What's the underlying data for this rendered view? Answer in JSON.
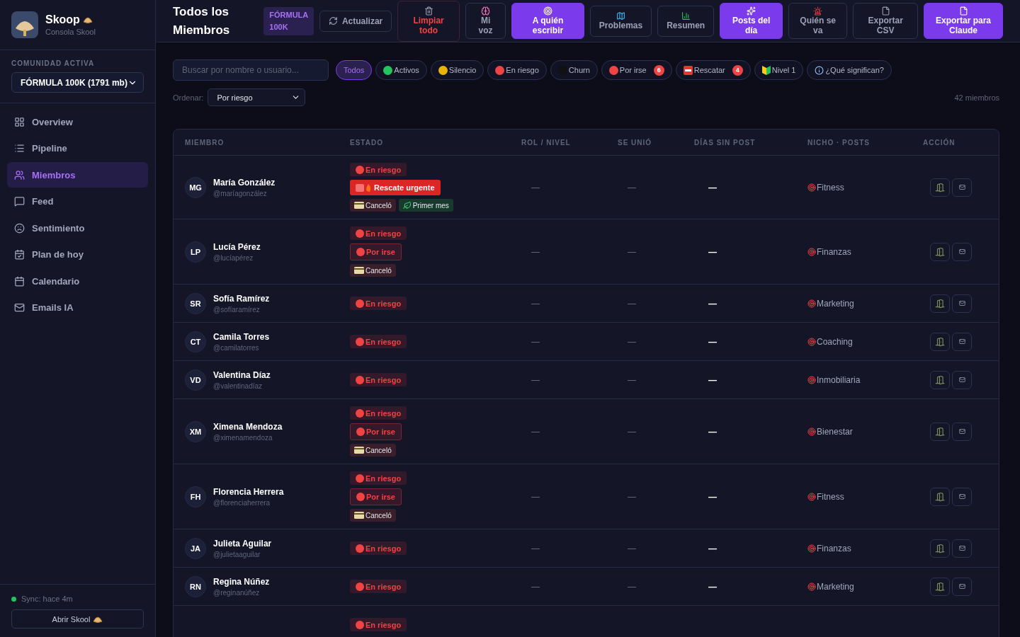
{
  "brand": {
    "name": "Skoop",
    "subtitle": "Consola Skool"
  },
  "community": {
    "label": "COMUNIDAD ACTIVA",
    "value": "FÓRMULA 100K (1791 mb)"
  },
  "nav": [
    {
      "label": "Overview",
      "selected": false
    },
    {
      "label": "Pipeline",
      "selected": false
    },
    {
      "label": "Miembros",
      "selected": true
    },
    {
      "label": "Feed",
      "selected": false
    },
    {
      "label": "Sentimiento",
      "selected": false
    },
    {
      "label": "Plan de hoy",
      "selected": false
    },
    {
      "label": "Calendario",
      "selected": false
    },
    {
      "label": "Emails IA",
      "selected": false
    }
  ],
  "sync": {
    "text": "Sync: hace 4m",
    "color": "#22c55e"
  },
  "open_button": "Abrir Skool",
  "header": {
    "title": "Todos los Miembros",
    "badge": "FÓRMULA 100K"
  },
  "toolbar": [
    {
      "label": "Actualizar",
      "kind": "plain"
    },
    {
      "label": "Limpiar todo",
      "kind": "danger"
    },
    {
      "label": "Mi voz",
      "kind": "plain"
    },
    {
      "label": "A quién escribir",
      "kind": "primary"
    },
    {
      "label": "Problemas",
      "kind": "plain"
    },
    {
      "label": "Resumen",
      "kind": "plain"
    },
    {
      "label": "Posts del día",
      "kind": "primary"
    },
    {
      "label": "Quién se va",
      "kind": "plain"
    },
    {
      "label": "Exportar CSV",
      "kind": "plain"
    },
    {
      "label": "Exportar para Claude",
      "kind": "primary"
    }
  ],
  "search": {
    "placeholder": "Buscar por nombre o usuario..."
  },
  "filters": [
    {
      "label": "Todos",
      "selected": true,
      "kind": "plain"
    },
    {
      "label": "Activos",
      "selected": false,
      "kind": "dot",
      "color": "#22c55e"
    },
    {
      "label": "Silencio",
      "selected": false,
      "kind": "dot",
      "color": "#eab308"
    },
    {
      "label": "En riesgo",
      "selected": false,
      "kind": "dot",
      "color": "#ef4444"
    },
    {
      "label": "Churn",
      "selected": false,
      "kind": "dot",
      "color": "#111111"
    },
    {
      "label": "Por irse",
      "selected": false,
      "kind": "dot",
      "color": "#ef4444",
      "count": "6"
    },
    {
      "label": "Rescatar",
      "selected": false,
      "kind": "sos",
      "count": "4"
    },
    {
      "label": "Nivel 1",
      "selected": false,
      "kind": "leaf"
    },
    {
      "label": "¿Qué significan?",
      "selected": false,
      "kind": "info"
    }
  ],
  "sort": {
    "label": "Ordenar:",
    "value": "Por riesgo"
  },
  "member_count": "42 miembros",
  "table": {
    "columns": [
      "MIEMBRO",
      "ESTADO",
      "ROL / NIVEL",
      "SE UNIÓ",
      "DÍAS SIN POST",
      "NICHO · POSTS",
      "ACCIÓN"
    ],
    "rows": [
      {
        "initials": "MG",
        "name": "María González",
        "handle": "@maríagonzález",
        "tags": [
          {
            "kind": "risk",
            "label": "En riesgo"
          },
          {
            "kind": "urgent",
            "label": "Rescate urgente"
          },
          {
            "kind": "cancel",
            "label": "Canceló"
          },
          {
            "kind": "new",
            "label": "Primer mes"
          }
        ],
        "role": "—",
        "joined": "—",
        "days": "—",
        "niche": "Fitness"
      },
      {
        "initials": "LP",
        "name": "Lucía Pérez",
        "handle": "@lucíapérez",
        "tags": [
          {
            "kind": "risk",
            "label": "En riesgo"
          },
          {
            "kind": "leaving",
            "label": "Por irse"
          },
          {
            "kind": "cancel",
            "label": "Canceló"
          }
        ],
        "role": "—",
        "joined": "—",
        "days": "—",
        "niche": "Finanzas"
      },
      {
        "initials": "SR",
        "name": "Sofía Ramírez",
        "handle": "@sofíaramírez",
        "tags": [
          {
            "kind": "risk",
            "label": "En riesgo"
          }
        ],
        "role": "—",
        "joined": "—",
        "days": "—",
        "niche": "Marketing"
      },
      {
        "initials": "CT",
        "name": "Camila Torres",
        "handle": "@camilatorres",
        "tags": [
          {
            "kind": "risk",
            "label": "En riesgo"
          }
        ],
        "role": "—",
        "joined": "—",
        "days": "—",
        "niche": "Coaching"
      },
      {
        "initials": "VD",
        "name": "Valentina Díaz",
        "handle": "@valentinadíaz",
        "tags": [
          {
            "kind": "risk",
            "label": "En riesgo"
          }
        ],
        "role": "—",
        "joined": "—",
        "days": "—",
        "niche": "Inmobiliaria"
      },
      {
        "initials": "XM",
        "name": "Ximena Mendoza",
        "handle": "@ximenamendoza",
        "tags": [
          {
            "kind": "risk",
            "label": "En riesgo"
          },
          {
            "kind": "leaving",
            "label": "Por irse"
          },
          {
            "kind": "cancel",
            "label": "Canceló"
          }
        ],
        "role": "—",
        "joined": "—",
        "days": "—",
        "niche": "Bienestar"
      },
      {
        "initials": "FH",
        "name": "Florencia Herrera",
        "handle": "@florenciaherrera",
        "tags": [
          {
            "kind": "risk",
            "label": "En riesgo"
          },
          {
            "kind": "leaving",
            "label": "Por irse"
          },
          {
            "kind": "cancel",
            "label": "Canceló"
          }
        ],
        "role": "—",
        "joined": "—",
        "days": "—",
        "niche": "Fitness"
      },
      {
        "initials": "JA",
        "name": "Julieta Aguilar",
        "handle": "@julietaaguilar",
        "tags": [
          {
            "kind": "risk",
            "label": "En riesgo"
          }
        ],
        "role": "—",
        "joined": "—",
        "days": "—",
        "niche": "Finanzas"
      },
      {
        "initials": "RN",
        "name": "Regina Núñez",
        "handle": "@reginanúñez",
        "tags": [
          {
            "kind": "risk",
            "label": "En riesgo"
          }
        ],
        "role": "—",
        "joined": "—",
        "days": "—",
        "niche": "Marketing"
      },
      {
        "tags": [
          {
            "kind": "risk",
            "label": "En riesgo"
          }
        ]
      }
    ]
  }
}
